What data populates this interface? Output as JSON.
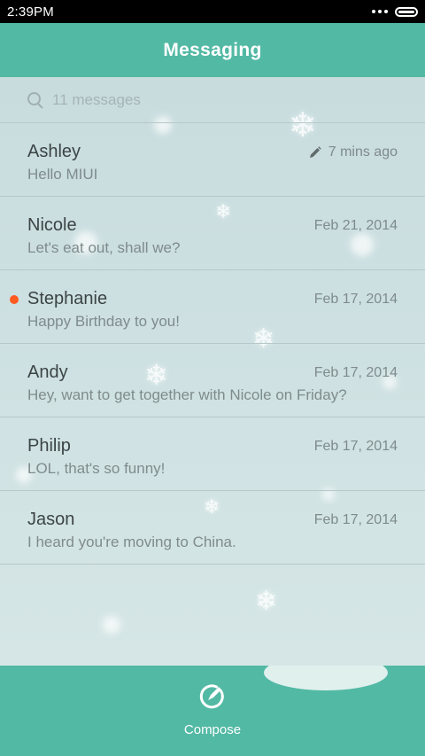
{
  "status_bar": {
    "time": "2:39PM"
  },
  "header": {
    "title": "Messaging"
  },
  "search": {
    "placeholder": "11 messages"
  },
  "messages": [
    {
      "name": "Ashley",
      "preview": "Hello MIUI",
      "date": "7 mins ago",
      "draft": true,
      "unread": false
    },
    {
      "name": "Nicole",
      "preview": "Let's eat out, shall we?",
      "date": "Feb 21, 2014",
      "draft": false,
      "unread": false
    },
    {
      "name": "Stephanie",
      "preview": "Happy Birthday to you!",
      "date": "Feb 17, 2014",
      "draft": false,
      "unread": true
    },
    {
      "name": "Andy",
      "preview": "Hey, want to get together with Nicole on Friday?",
      "date": "Feb 17, 2014",
      "draft": false,
      "unread": false
    },
    {
      "name": "Philip",
      "preview": "LOL, that's so funny!",
      "date": "Feb 17, 2014",
      "draft": false,
      "unread": false
    },
    {
      "name": "Jason",
      "preview": "I heard you're moving to China.",
      "date": "Feb 17, 2014",
      "draft": false,
      "unread": false
    }
  ],
  "bottom_bar": {
    "compose_label": "Compose"
  },
  "colors": {
    "accent": "#52b9a4",
    "unread": "#ff5a1f",
    "background": "#cfe0e1"
  },
  "icons": [
    "search-icon",
    "pencil-icon",
    "compose-icon",
    "battery-icon",
    "more-icon",
    "snowflake-icon"
  ]
}
